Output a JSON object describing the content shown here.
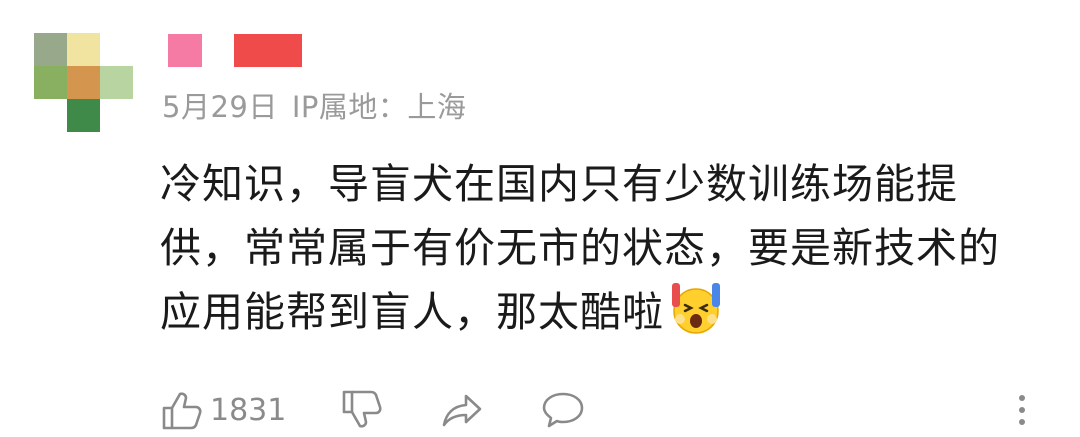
{
  "comment": {
    "user": {
      "avatar_icon": "pixelated-avatar-icon",
      "avatar_colors": [
        "#98a88a",
        "#f0e4a0",
        "#ffffff",
        "#88b060",
        "#d4954e",
        "#b8d4a0",
        "#ffffff",
        "#3f8a48",
        "#ffffff"
      ],
      "name_block_colors": [
        "#f57aa4",
        "#ef4b4b"
      ]
    },
    "meta": {
      "date": "5月29日",
      "location": "IP属地：上海"
    },
    "text_lines": [
      "冷知识，导盲犬在国内只有少数训练场能提",
      "供，常常属于有价无市的状态，要是新技术的",
      "应用能帮到盲人，那太酷啦"
    ],
    "emoji": "shocked-face-emoji",
    "actions": {
      "like_icon": "thumbs-up-icon",
      "like_count": "1831",
      "dislike_icon": "thumbs-down-icon",
      "share_icon": "share-arrow-icon",
      "reply_icon": "speech-bubble-icon",
      "more_icon": "more-vertical-icon"
    }
  }
}
